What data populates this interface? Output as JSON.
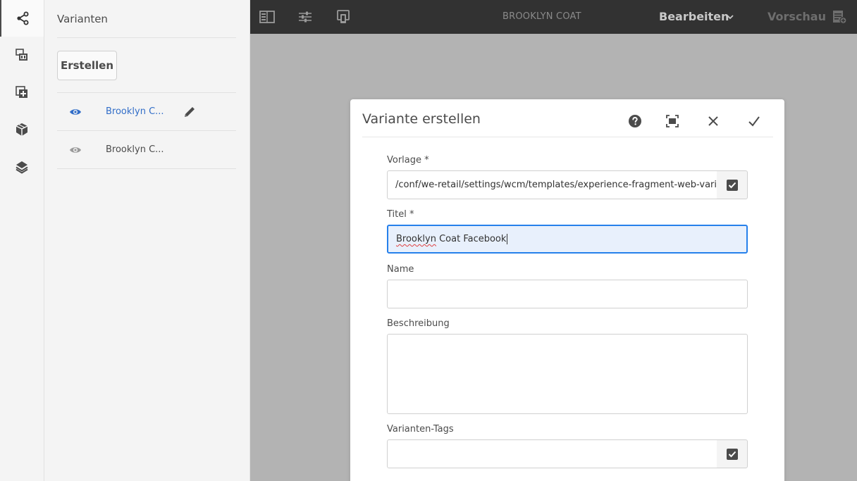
{
  "rail": {
    "items": [
      {
        "icon": "variations-icon",
        "active": true
      },
      {
        "icon": "assets-icon",
        "active": false
      },
      {
        "icon": "components-icon",
        "active": false
      },
      {
        "icon": "content-tree-icon",
        "active": false
      },
      {
        "icon": "layers-icon",
        "active": false
      }
    ]
  },
  "panel": {
    "title": "Varianten",
    "create_label": "Erstellen",
    "variants": [
      {
        "label": "Brooklyn C...",
        "active": true
      },
      {
        "label": "Brooklyn C...",
        "active": false
      }
    ]
  },
  "toolbar": {
    "title": "BROOKLYN COAT",
    "mode_label": "Bearbeiten",
    "preview_label": "Vorschau"
  },
  "dialog": {
    "title": "Variante erstellen",
    "template_label": "Vorlage *",
    "template_value": "/conf/we-retail/settings/wcm/templates/experience-fragment-web-variation",
    "title_label": "Titel *",
    "title_value_word1": "Brooklyn",
    "title_value_rest": " Coat Facebook",
    "name_label": "Name",
    "name_value": "",
    "description_label": "Beschreibung",
    "description_value": "",
    "tags_label": "Varianten-Tags",
    "tags_value": ""
  },
  "colors": {
    "accent": "#326ec8",
    "focus_border": "#2680eb",
    "toolbar_bg": "#323232",
    "canvas_bg": "#b3b3b3"
  }
}
